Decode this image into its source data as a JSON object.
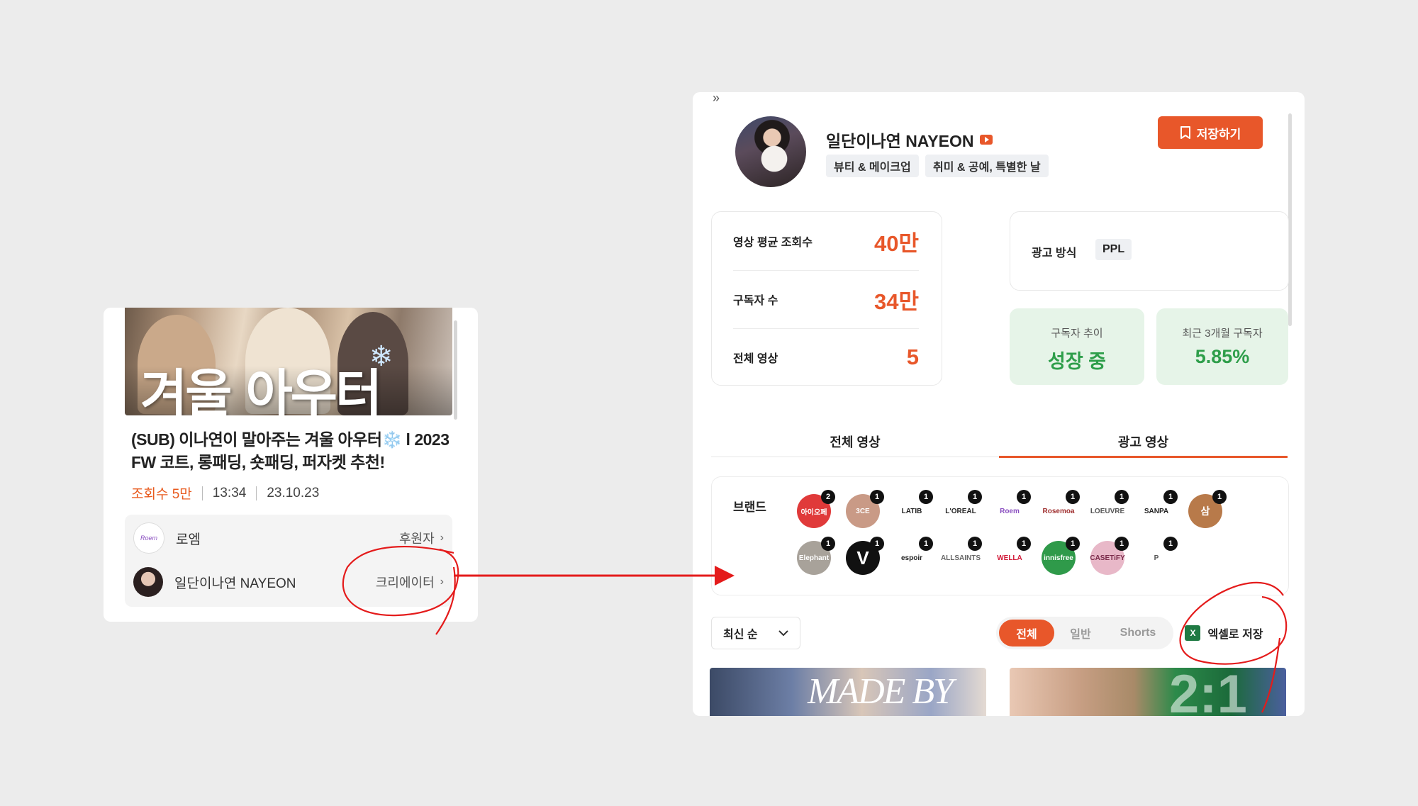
{
  "video_card": {
    "thumbnail_text": "겨울 아우터",
    "title": "(SUB) 이나연이 말아주는 겨울 아우터❄️ l 2023 FW 코트, 롱패딩, 숏패딩, 퍼자켓 추천!",
    "views": "조회수 5만",
    "duration": "13:34",
    "date": "23.10.23",
    "sponsor": {
      "name": "로엠",
      "avatar_text": "Roem",
      "role": "후원자"
    },
    "creator": {
      "name": "일단이나연 NAYEON",
      "role": "크리에이터"
    }
  },
  "channel": {
    "name": "일단이나연 NAYEON",
    "categories": [
      "뷰티 & 메이크업",
      "취미 & 공예, 특별한 날"
    ],
    "save_label": "저장하기"
  },
  "stats": [
    {
      "label": "영상 평균 조회수",
      "value": "40만"
    },
    {
      "label": "구독자 수",
      "value": "34만"
    },
    {
      "label": "전체 영상",
      "value": "5"
    }
  ],
  "ad": {
    "label": "광고 방식",
    "type": "PPL"
  },
  "growth": {
    "trend_label": "구독자 추이",
    "trend_value": "성장 중",
    "recent_label": "최근 3개월 구독자",
    "recent_value": "5.85%"
  },
  "tabs": [
    {
      "label": "전체 영상",
      "active": false
    },
    {
      "label": "광고 영상",
      "active": true
    }
  ],
  "brands": {
    "label": "브랜드",
    "items": [
      {
        "name": "아이오페",
        "count": "2",
        "bg": "#e03a3a",
        "fg": "#ffffff"
      },
      {
        "name": "3CE",
        "count": "1",
        "bg": "#c99a86",
        "fg": "#ffffff"
      },
      {
        "name": "LATIB",
        "count": "1",
        "bg": "#ffffff",
        "fg": "#222222"
      },
      {
        "name": "L'OREAL",
        "count": "1",
        "bg": "#ffffff",
        "fg": "#222222"
      },
      {
        "name": "Roem",
        "count": "1",
        "bg": "#ffffff",
        "fg": "#8a4fc0"
      },
      {
        "name": "Rosemoa",
        "count": "1",
        "bg": "#ffffff",
        "fg": "#a03030"
      },
      {
        "name": "LOEUVRE",
        "count": "1",
        "bg": "#ffffff",
        "fg": "#555555"
      },
      {
        "name": "SANPA",
        "count": "1",
        "bg": "#ffffff",
        "fg": "#222222"
      },
      {
        "name": "삼",
        "count": "1",
        "bg": "#b87a4a",
        "fg": "#ffffff"
      },
      {
        "name": "Elephant",
        "count": "1",
        "bg": "#a8a29a",
        "fg": "#ffffff"
      },
      {
        "name": "V",
        "count": "1",
        "bg": "#111111",
        "fg": "#ffffff"
      },
      {
        "name": "espoir",
        "count": "1",
        "bg": "#ffffff",
        "fg": "#222222"
      },
      {
        "name": "ALLSAINTS",
        "count": "1",
        "bg": "#ffffff",
        "fg": "#666666"
      },
      {
        "name": "WELLA",
        "count": "1",
        "bg": "#ffffff",
        "fg": "#d21b3a"
      },
      {
        "name": "innisfree",
        "count": "1",
        "bg": "#2f9a4a",
        "fg": "#ffffff"
      },
      {
        "name": "CASETiFY",
        "count": "1",
        "bg": "#e8b8c8",
        "fg": "#7a2a4a"
      },
      {
        "name": "P",
        "count": "1",
        "bg": "#ffffff",
        "fg": "#555555"
      }
    ]
  },
  "controls": {
    "sort_label": "최신 순",
    "filters": [
      {
        "label": "전체",
        "active": true
      },
      {
        "label": "일반",
        "active": false
      },
      {
        "label": "Shorts",
        "active": false
      }
    ],
    "excel_label": "엑셀로 저장"
  },
  "video_thumbs": [
    {
      "text": "MADE BY"
    },
    {
      "text": "2:1"
    }
  ],
  "colors": {
    "accent": "#e8572a",
    "green": "#2e9e4a",
    "annotation": "#e41b1b"
  }
}
